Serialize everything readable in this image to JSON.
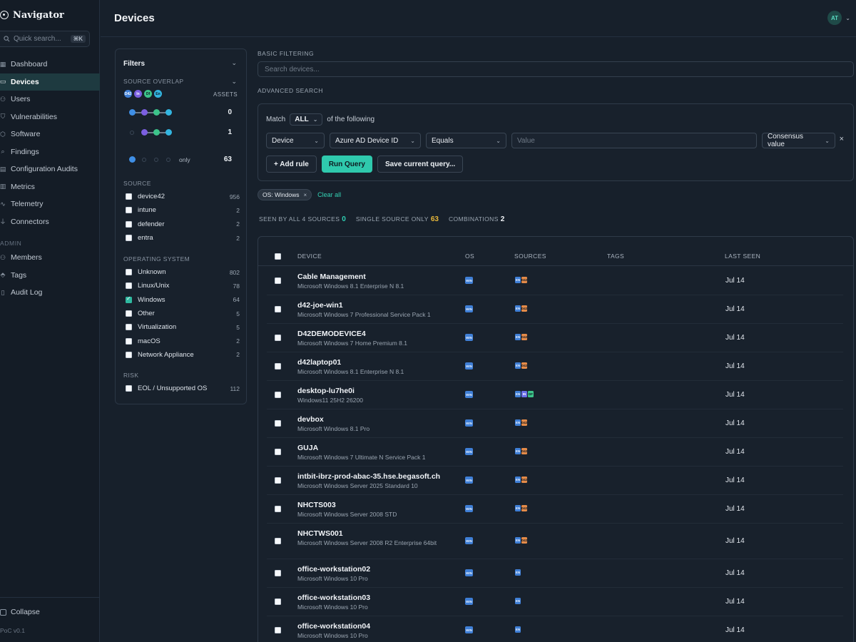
{
  "app": {
    "name": "Navigator",
    "version": "PoC v0.1"
  },
  "sidebar": {
    "search_placeholder": "Quick search...",
    "search_shortcut": "⌘K",
    "items": [
      {
        "label": "Dashboard",
        "icon": "grid-icon"
      },
      {
        "label": "Devices",
        "icon": "monitor-icon",
        "active": true
      },
      {
        "label": "Users",
        "icon": "users-icon"
      },
      {
        "label": "Vulnerabilities",
        "icon": "shield-icon"
      },
      {
        "label": "Software",
        "icon": "cube-icon"
      },
      {
        "label": "Findings",
        "icon": "search-icon"
      },
      {
        "label": "Configuration Audits",
        "icon": "clipboard-icon"
      },
      {
        "label": "Metrics",
        "icon": "chart-icon"
      },
      {
        "label": "Telemetry",
        "icon": "activity-icon"
      },
      {
        "label": "Connectors",
        "icon": "plug-icon"
      }
    ],
    "admin_label": "ADMIN",
    "admin_items": [
      {
        "label": "Members",
        "icon": "members-icon"
      },
      {
        "label": "Tags",
        "icon": "tag-icon"
      },
      {
        "label": "Audit Log",
        "icon": "file-icon"
      }
    ],
    "collapse_label": "Collapse"
  },
  "header": {
    "title": "Devices",
    "avatar_initials": "AT"
  },
  "filters": {
    "title": "Filters",
    "source_overlap": {
      "label": "SOURCE OVERLAP",
      "sources": [
        "D42",
        "In",
        "Df",
        "En"
      ],
      "assets_label": "ASSETS",
      "rows": [
        {
          "count": "0"
        },
        {
          "count": "1"
        },
        {
          "only_label": "only",
          "count": "63"
        }
      ]
    },
    "source": {
      "label": "SOURCE",
      "items": [
        {
          "label": "device42",
          "count": "956"
        },
        {
          "label": "intune",
          "count": "2"
        },
        {
          "label": "defender",
          "count": "2"
        },
        {
          "label": "entra",
          "count": "2"
        }
      ]
    },
    "os": {
      "label": "OPERATING SYSTEM",
      "items": [
        {
          "label": "Unknown",
          "count": "802",
          "checked": false
        },
        {
          "label": "Linux/Unix",
          "count": "78",
          "checked": false
        },
        {
          "label": "Windows",
          "count": "64",
          "checked": true
        },
        {
          "label": "Other",
          "count": "5",
          "checked": false
        },
        {
          "label": "Virtualization",
          "count": "5",
          "checked": false
        },
        {
          "label": "macOS",
          "count": "2",
          "checked": false
        },
        {
          "label": "Network Appliance",
          "count": "2",
          "checked": false
        }
      ]
    },
    "risk": {
      "label": "RISK",
      "items": [
        {
          "label": "EOL / Unsupported OS",
          "count": "112"
        }
      ]
    }
  },
  "main": {
    "basic_label": "BASIC FILTERING",
    "search_placeholder": "Search devices...",
    "advanced_label": "ADVANCED SEARCH",
    "match_label": "Match",
    "match_value": "ALL",
    "match_suffix": "of the following",
    "rule": {
      "entity": "Device",
      "field": "Azure AD Device ID",
      "operator": "Equals",
      "value_placeholder": "Value",
      "mode": "Consensus value"
    },
    "add_rule": "+ Add rule",
    "run_query": "Run Query",
    "save_query": "Save current query...",
    "chip": "OS: Windows",
    "clear_all": "Clear all",
    "stats": {
      "all_label": "SEEN BY ALL 4 SOURCES",
      "all_value": "0",
      "single_label": "SINGLE SOURCE ONLY",
      "single_value": "63",
      "combo_label": "COMBINATIONS",
      "combo_value": "2"
    }
  },
  "table": {
    "columns": [
      "DEVICE",
      "OS",
      "SOURCES",
      "TAGS",
      "LAST SEEN"
    ],
    "rows": [
      {
        "name": "Cable Management",
        "os": "Microsoft Windows 8.1 Enterprise N 8.1",
        "sources": [
          "ent",
          "d42"
        ],
        "last_seen": "Jul 14"
      },
      {
        "name": "d42-joe-win1",
        "os": "Microsoft Windows 7 Professional Service Pack 1",
        "sources": [
          "ent",
          "d42"
        ],
        "last_seen": "Jul 14"
      },
      {
        "name": "D42DEMODEVICE4",
        "os": "Microsoft Windows 7 Home Premium 8.1",
        "sources": [
          "ent",
          "d42"
        ],
        "last_seen": "Jul 14"
      },
      {
        "name": "d42laptop01",
        "os": "Microsoft Windows 8.1 Enterprise N 8.1",
        "sources": [
          "ent",
          "d42"
        ],
        "last_seen": "Jul 14"
      },
      {
        "name": "desktop-lu7he0i",
        "os": "Windows11 25H2 26200",
        "sources": [
          "ent",
          "int",
          "def"
        ],
        "last_seen": "Jul 14"
      },
      {
        "name": "devbox",
        "os": "Microsoft Windows 8.1 Pro",
        "sources": [
          "ent",
          "d42"
        ],
        "last_seen": "Jul 14"
      },
      {
        "name": "GUJA",
        "os": "Microsoft Windows 7 Ultimate N Service Pack 1",
        "sources": [
          "ent",
          "d42"
        ],
        "last_seen": "Jul 14"
      },
      {
        "name": "intbit-ibrz-prod-abac-35.hse.begasoft.ch",
        "os": "Microsoft Windows Server 2025 Standard 10",
        "sources": [
          "ent",
          "d42"
        ],
        "last_seen": "Jul 14"
      },
      {
        "name": "NHCTS003",
        "os": "Microsoft Windows Server 2008 STD",
        "sources": [
          "ent",
          "d42"
        ],
        "last_seen": "Jul 14"
      },
      {
        "name": "NHCTWS001",
        "os": "Microsoft Windows Server 2008 R2 Enterprise 64bit",
        "sources": [
          "ent",
          "d42"
        ],
        "last_seen": "Jul 14",
        "tall": true
      },
      {
        "name": "office-workstation02",
        "os": "Microsoft Windows 10 Pro",
        "sources": [
          "ent"
        ],
        "last_seen": "Jul 14"
      },
      {
        "name": "office-workstation03",
        "os": "Microsoft Windows 10 Pro",
        "sources": [
          "ent"
        ],
        "last_seen": "Jul 14"
      },
      {
        "name": "office-workstation04",
        "os": "Microsoft Windows 10 Pro",
        "sources": [
          "ent"
        ],
        "last_seen": "Jul 14"
      }
    ]
  },
  "colors": {
    "accent": "#2fc9ad",
    "background": "#17202b",
    "entra": "#3f7fd6",
    "device42": "#e48b49",
    "intune": "#6a6fe8",
    "defender": "#3cc48a"
  }
}
